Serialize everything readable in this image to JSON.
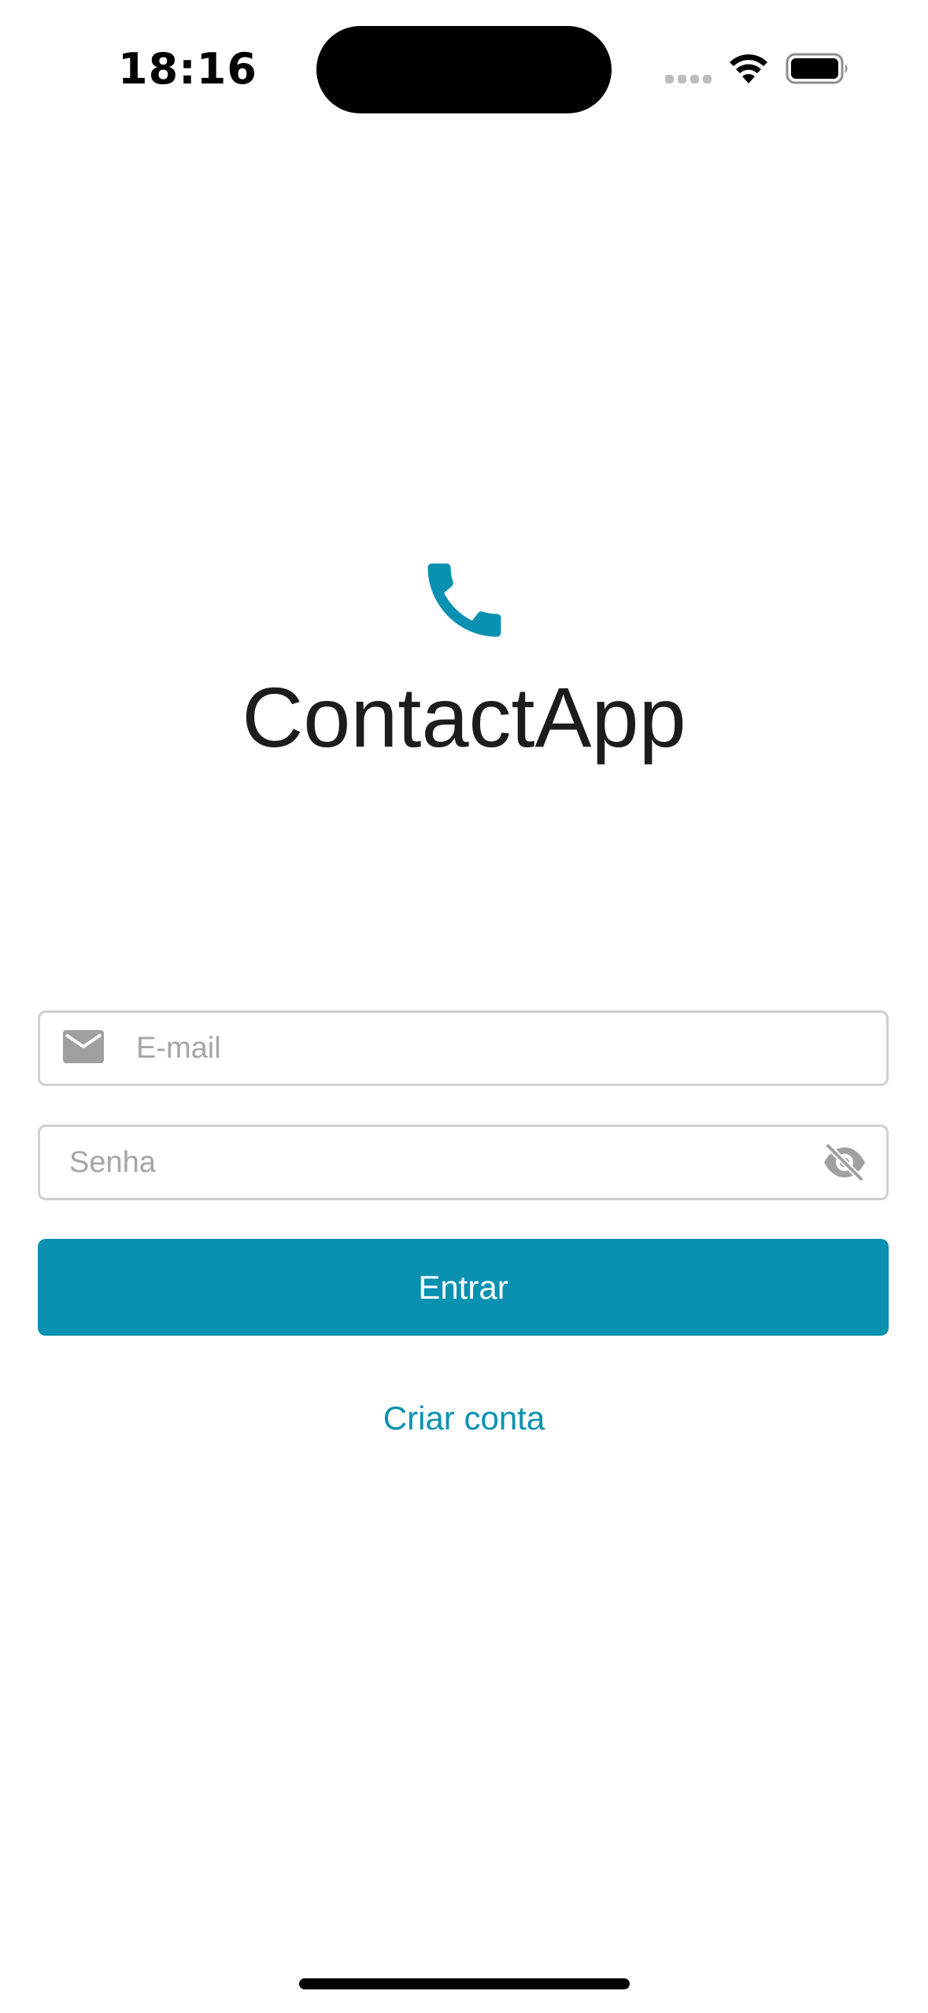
{
  "status_bar": {
    "time": "18:16"
  },
  "app": {
    "logo_icon": "phone-icon",
    "title": "ContactApp"
  },
  "form": {
    "email": {
      "icon": "mail-icon",
      "placeholder": "E-mail",
      "value": ""
    },
    "password": {
      "placeholder": "Senha",
      "value": "",
      "toggle_icon": "eye-off-icon"
    },
    "submit_label": "Entrar",
    "create_account_label": "Criar conta"
  },
  "colors": {
    "accent": "#0a91b2",
    "border": "#d0d0d0",
    "placeholder": "#a6a6a6",
    "icon_gray": "#a0a0a0",
    "text": "#1c1c1e"
  }
}
